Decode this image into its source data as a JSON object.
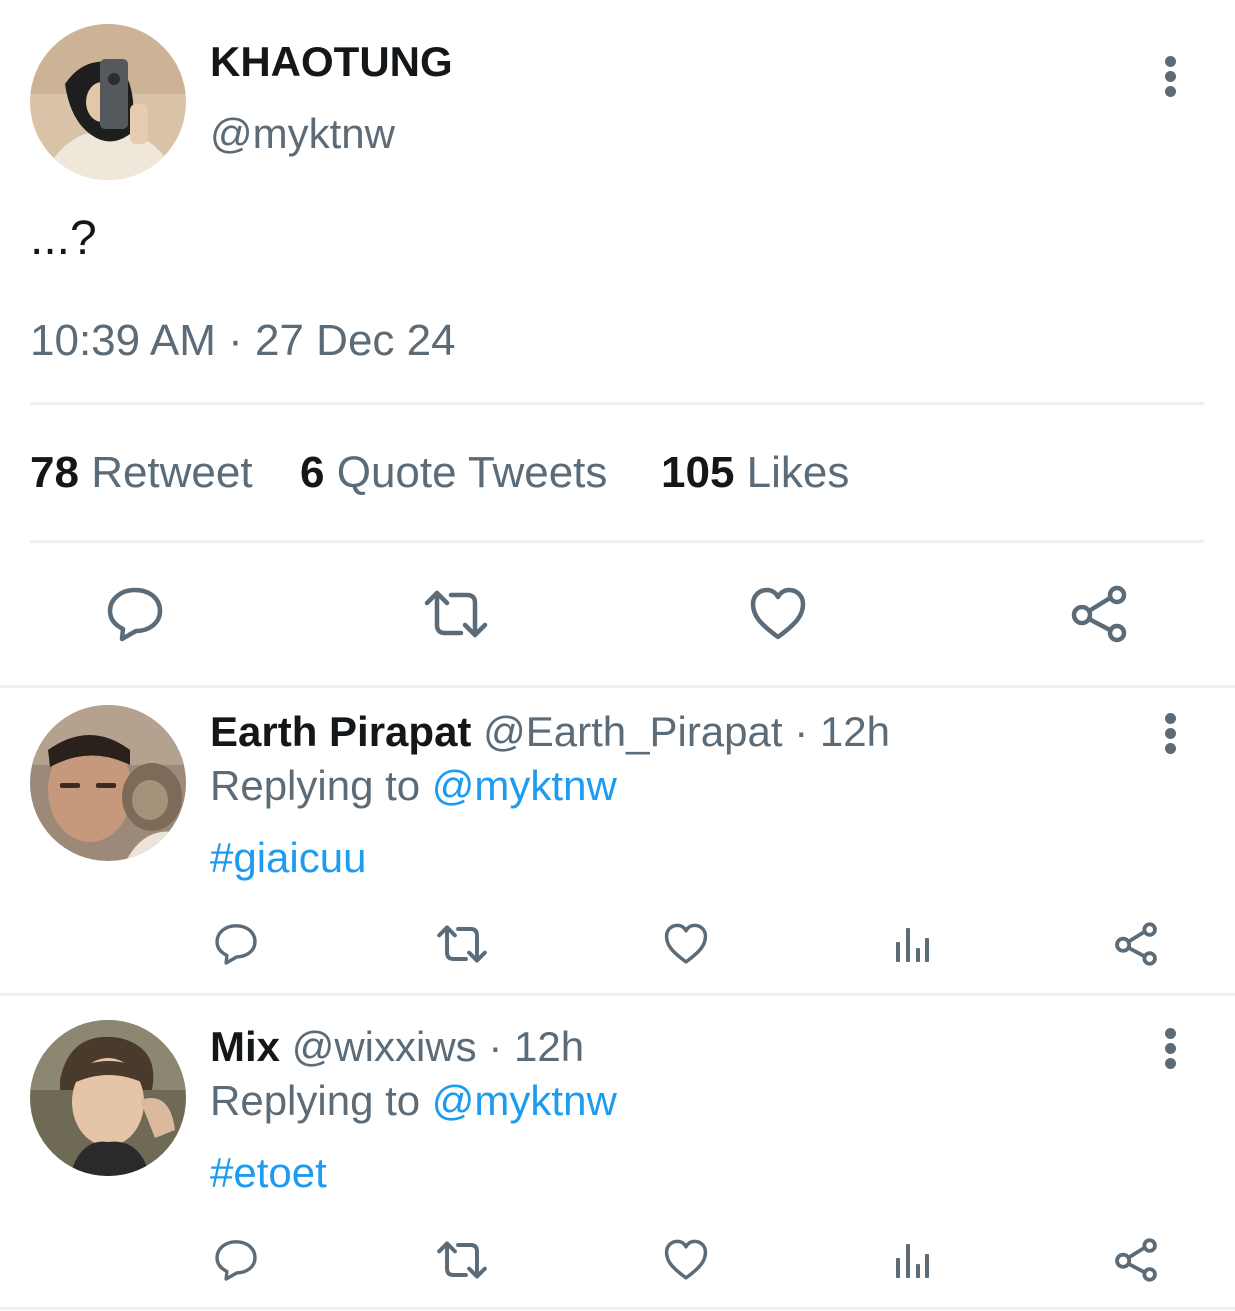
{
  "tweet": {
    "display_name": "KHAOTUNG",
    "handle": "@myktnw",
    "text": "...?",
    "timestamp": "10:39 AM · 27 Dec 24",
    "avatar_icon": "profile-photo-avatar",
    "stats": {
      "retweets_count": "78",
      "retweets_label": "Retweet",
      "quotes_count": "6",
      "quotes_label": "Quote Tweets",
      "likes_count": "105",
      "likes_label": "Likes"
    },
    "actions": [
      "reply-icon",
      "retweet-icon",
      "like-icon",
      "share-icon"
    ]
  },
  "replies": [
    {
      "display_name": "Earth Pirapat",
      "handle": "@Earth_Pirapat",
      "separator": "·",
      "time": "12h",
      "replying_label": "Replying to",
      "replying_to": "@myktnw",
      "text": "#giaicuu",
      "actions": [
        "reply-icon",
        "retweet-icon",
        "like-icon",
        "analytics-icon",
        "share-icon"
      ]
    },
    {
      "display_name": "Mix",
      "handle": "@wixxiws",
      "separator": "·",
      "time": "12h",
      "replying_label": "Replying to",
      "replying_to": "@myktnw",
      "text": "#etoet",
      "actions": [
        "reply-icon",
        "retweet-icon",
        "like-icon",
        "analytics-icon",
        "share-icon"
      ]
    }
  ],
  "colors": {
    "text_primary": "#14171a",
    "text_secondary": "#5b6b78",
    "link": "#1d9bf0",
    "divider": "#eef1f3"
  }
}
